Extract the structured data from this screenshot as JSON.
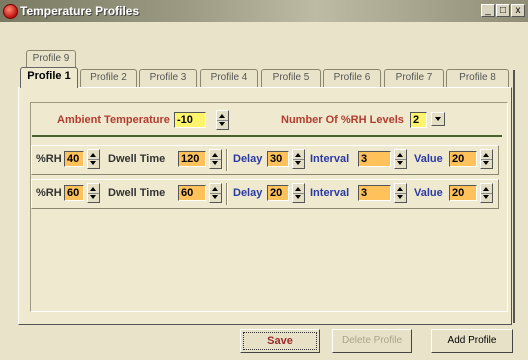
{
  "window": {
    "title": "Temperature Profiles",
    "controls": [
      "_",
      "□",
      "x"
    ]
  },
  "tabs": {
    "back_row": [
      {
        "label": "Profile 9"
      }
    ],
    "front_row": [
      {
        "label": "Profile 1",
        "active": true
      },
      {
        "label": "Profile 2"
      },
      {
        "label": "Profile 3"
      },
      {
        "label": "Profile 4"
      },
      {
        "label": "Profile 5"
      },
      {
        "label": "Profile 6"
      },
      {
        "label": "Profile 7"
      },
      {
        "label": "Profile 8"
      }
    ]
  },
  "settings": {
    "ambient_label": "Ambient Temperature",
    "ambient_value": "-10",
    "rh_levels_label": "Number Of %RH Levels",
    "rh_levels_value": "2"
  },
  "levels": [
    {
      "rh_label": "%RH",
      "rh": "40",
      "dwell_label": "Dwell Time",
      "dwell": "120",
      "delay_label": "Delay",
      "delay": "30",
      "interval_label": "Interval",
      "interval": "3",
      "value_label": "Value",
      "value": "20"
    },
    {
      "rh_label": "%RH",
      "rh": "60",
      "dwell_label": "Dwell Time",
      "dwell": "60",
      "delay_label": "Delay",
      "delay": "20",
      "interval_label": "Interval",
      "interval": "3",
      "value_label": "Value",
      "value": "20"
    }
  ],
  "buttons": {
    "save": "Save",
    "delete": "Delete Profile",
    "add": "Add Profile"
  },
  "colors": {
    "accent_label": "#b23d2f",
    "field_label": "#2a3aa5",
    "input_yellow": "#fff46a",
    "input_orange": "#ffc25a",
    "separator": "#49612f"
  }
}
